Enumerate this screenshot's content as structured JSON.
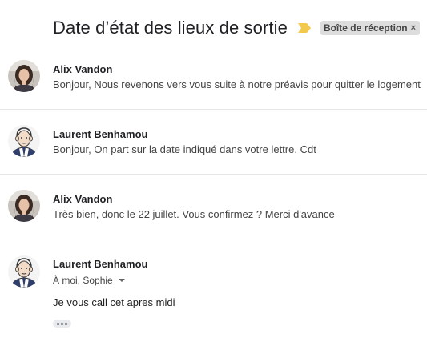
{
  "thread": {
    "subject": "Date d’état des lieux de sortie",
    "importance_color": "#f2c94c",
    "label": "Boîte de réception",
    "label_remove": "×"
  },
  "messages": [
    {
      "sender": "Alix Vandon",
      "snippet": "Bonjour, Nous revenons vers vous suite à notre préavis pour quitter le logement",
      "avatar": "photo-woman"
    },
    {
      "sender": "Laurent Benhamou",
      "snippet": "Bonjour, On part sur la date indiqué dans votre lettre. Cdt",
      "avatar": "caricature-man"
    },
    {
      "sender": "Alix Vandon",
      "snippet": "Très bien, donc le 22 juillet. Vous confirmez ? Merci d'avance",
      "avatar": "photo-woman"
    },
    {
      "sender": "Laurent Benhamou",
      "recipients": "À moi, Sophie",
      "body": "Je vous call cet apres midi",
      "avatar": "caricature-man"
    }
  ]
}
